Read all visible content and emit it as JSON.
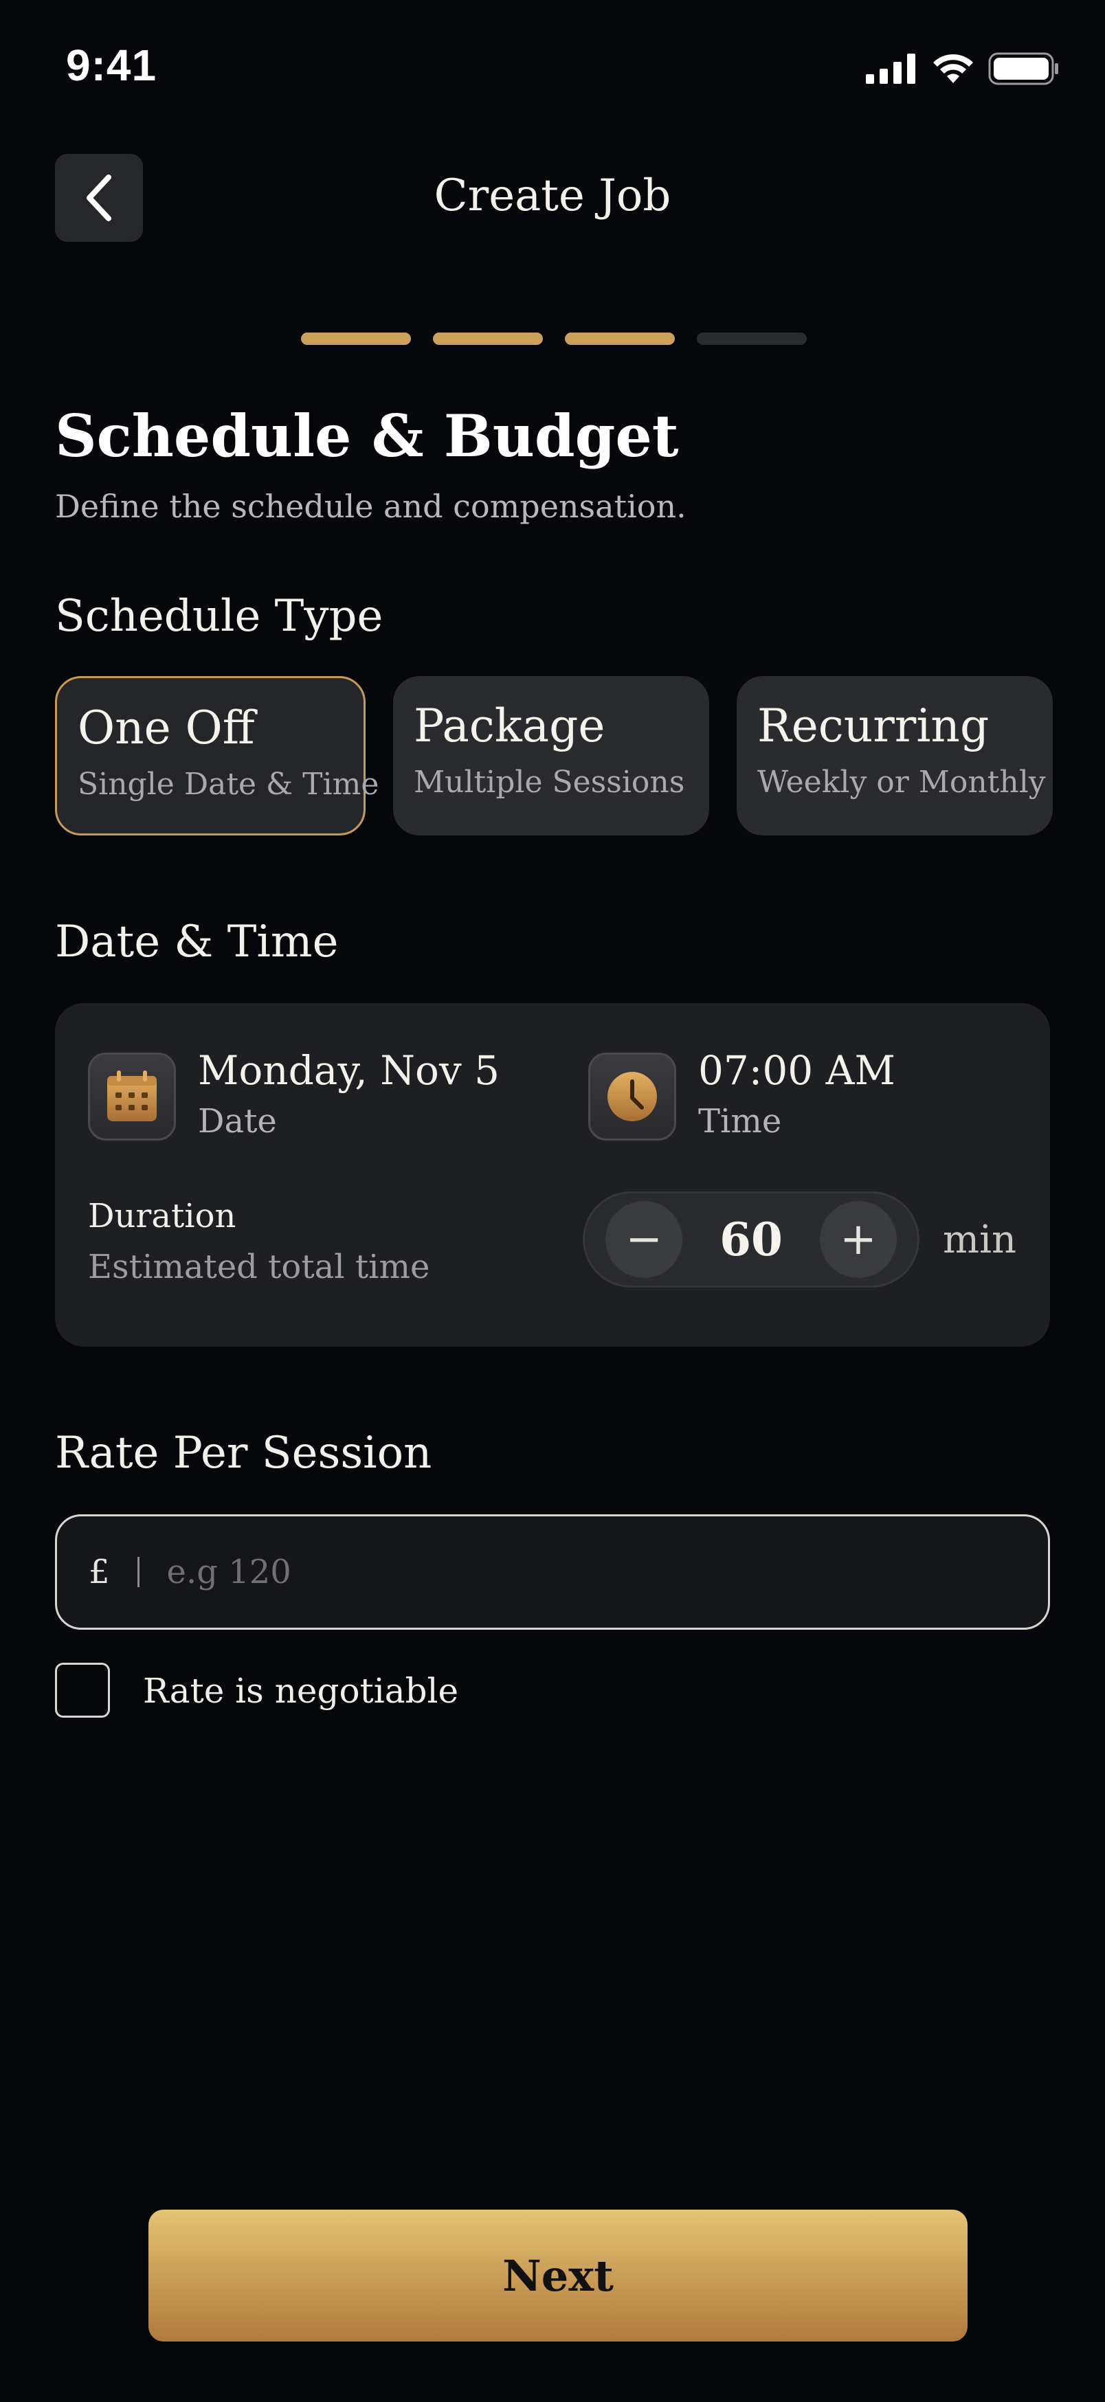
{
  "status_bar": {
    "time": "9:41"
  },
  "header": {
    "title": "Create Job"
  },
  "progress": {
    "step": 3,
    "total": 4
  },
  "section": {
    "title": "Schedule & Budget",
    "subtitle": "Define the schedule and compensation."
  },
  "schedule_type": {
    "label": "Schedule Type",
    "options": [
      {
        "title": "One Off",
        "subtitle": "Single Date & Time",
        "selected": true
      },
      {
        "title": "Package",
        "subtitle": "Multiple Sessions",
        "selected": false
      },
      {
        "title": "Recurring",
        "subtitle": "Weekly or Monthly",
        "selected": false
      }
    ]
  },
  "date_time": {
    "label": "Date & Time",
    "date_value": "Monday, Nov 5",
    "date_label": "Date",
    "time_value": "07:00 AM",
    "time_label": "Time",
    "duration_label": "Duration",
    "duration_sub": "Estimated total time",
    "duration_value": "60",
    "duration_unit": "min",
    "minus": "−",
    "plus": "+"
  },
  "rate": {
    "label": "Rate Per Session",
    "currency": "£",
    "placeholder": "e.g 120",
    "negotiable_label": "Rate is negotiable",
    "negotiable_checked": false
  },
  "actions": {
    "next_label": "Next"
  },
  "colors": {
    "accent": "#c89a56",
    "background": "#06070a"
  }
}
